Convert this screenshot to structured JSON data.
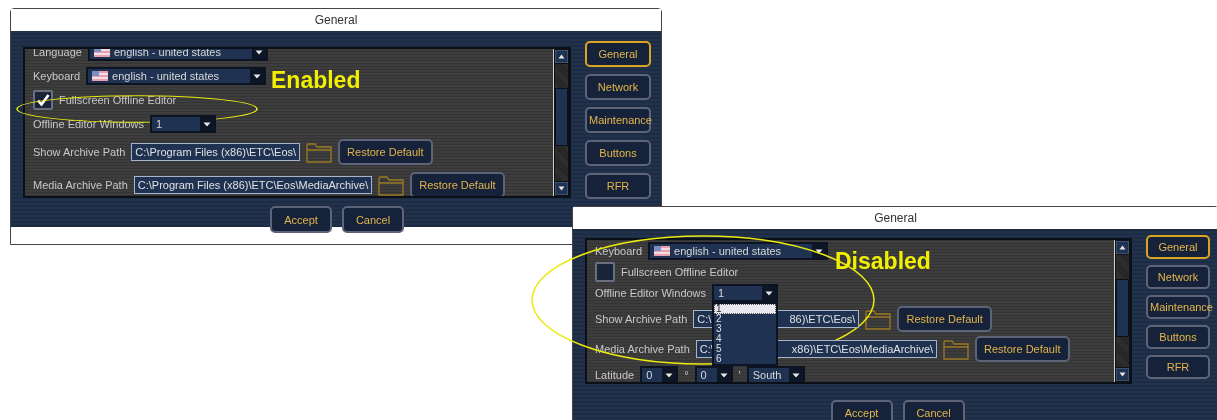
{
  "windows": [
    {
      "title": "General",
      "annotation": {
        "label": "Enabled"
      },
      "settings": [
        {
          "kind": "locale",
          "label": "Language",
          "value": "english - united states"
        },
        {
          "kind": "locale",
          "label": "Keyboard",
          "value": "english - united states"
        },
        {
          "kind": "checkbox",
          "label": "Fullscreen Offline Editor",
          "checked": true
        },
        {
          "kind": "dropdown",
          "label": "Offline Editor Windows",
          "value": "1"
        },
        {
          "kind": "path",
          "label": "Show Archive Path",
          "value_parts": [
            "C:\\Program Files (x86)\\ETC\\Eos\\"
          ],
          "button": "Restore Default"
        },
        {
          "kind": "path",
          "label": "Media Archive Path",
          "value_parts": [
            "C:\\Program Files (x86)\\ETC\\Eos\\MediaArchive\\"
          ],
          "button": "Restore Default"
        }
      ],
      "tabs": [
        {
          "label": "General",
          "selected": true
        },
        {
          "label": "Network",
          "selected": false
        },
        {
          "label": "Maintenance",
          "selected": false
        },
        {
          "label": "Buttons",
          "selected": false
        },
        {
          "label": "RFR",
          "selected": false
        }
      ],
      "buttons": [
        "Accept",
        "Cancel"
      ]
    },
    {
      "title": "General",
      "annotation": {
        "label": "Disabled"
      },
      "settings": [
        {
          "kind": "locale",
          "label": "Keyboard",
          "value": "english - united states"
        },
        {
          "kind": "checkbox",
          "label": "Fullscreen Offline Editor",
          "checked": false
        },
        {
          "kind": "dropdown",
          "label": "Offline Editor Windows",
          "value": "1",
          "options": [
            {
              "label": "1",
              "selected": true
            },
            {
              "label": "2",
              "selected": false
            },
            {
              "label": "3",
              "selected": false
            },
            {
              "label": "4",
              "selected": false
            },
            {
              "label": "5",
              "selected": false
            },
            {
              "label": "6",
              "selected": false
            }
          ]
        },
        {
          "kind": "path",
          "label": "Show Archive Path",
          "value_parts": [
            "C:\\",
            "86)\\ETC\\Eos\\"
          ],
          "button": "Restore Default"
        },
        {
          "kind": "path",
          "label": "Media Archive Path",
          "value_parts": [
            "C:\\",
            "x86)\\ETC\\Eos\\MediaArchive\\"
          ],
          "button": "Restore Default"
        },
        {
          "kind": "latitude",
          "label": "Latitude",
          "fields": [
            "0",
            "0",
            "South"
          ],
          "separators": [
            "°",
            "'"
          ]
        }
      ],
      "tabs": [
        {
          "label": "General",
          "selected": true
        },
        {
          "label": "Network",
          "selected": false
        },
        {
          "label": "Maintenance",
          "selected": false
        },
        {
          "label": "Buttons",
          "selected": false
        },
        {
          "label": "RFR",
          "selected": false
        }
      ],
      "buttons": [
        "Accept",
        "Cancel"
      ]
    }
  ]
}
